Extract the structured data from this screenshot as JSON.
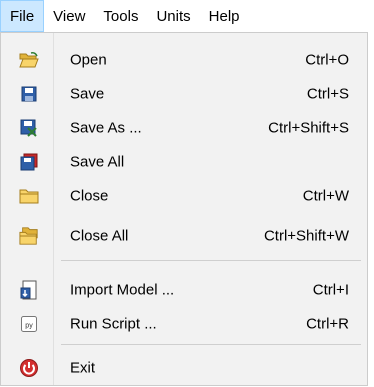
{
  "menubar": {
    "items": [
      {
        "label": "File"
      },
      {
        "label": "View"
      },
      {
        "label": "Tools"
      },
      {
        "label": "Units"
      },
      {
        "label": "Help"
      }
    ]
  },
  "file_menu": {
    "items": [
      {
        "label": "Open",
        "shortcut": "Ctrl+O",
        "icon": "open-folder-icon"
      },
      {
        "label": "Save",
        "shortcut": "Ctrl+S",
        "icon": "save-icon"
      },
      {
        "label": "Save As ...",
        "shortcut": "Ctrl+Shift+S",
        "icon": "save-as-icon"
      },
      {
        "label": "Save All",
        "shortcut": "",
        "icon": "save-all-icon"
      },
      {
        "label": "Close",
        "shortcut": "Ctrl+W",
        "icon": "folder-icon"
      },
      {
        "label": "Close All",
        "shortcut": "Ctrl+Shift+W",
        "icon": "folders-icon"
      },
      {
        "label": "Import Model ...",
        "shortcut": "Ctrl+I",
        "icon": "import-model-icon"
      },
      {
        "label": "Run Script ...",
        "shortcut": "Ctrl+R",
        "icon": "python-script-icon"
      },
      {
        "label": "Exit",
        "shortcut": "",
        "icon": "exit-icon"
      }
    ],
    "script_icon_text": "py"
  }
}
